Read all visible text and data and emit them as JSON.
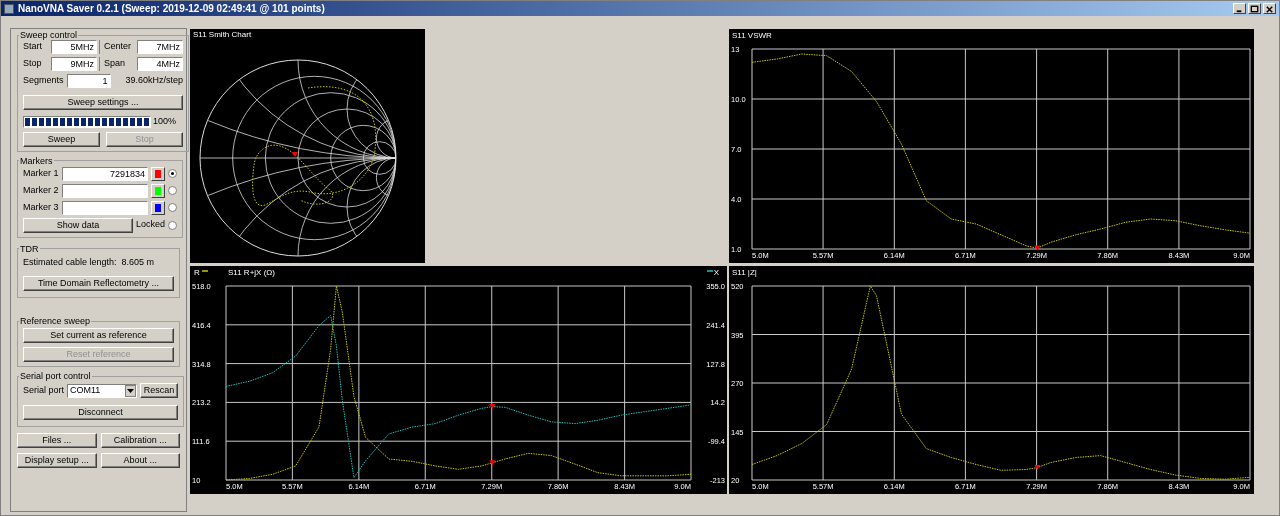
{
  "window": {
    "title": "NanoVNA Saver 0.2.1 (Sweep: 2019-12-09 02:49:41 @ 101 points)"
  },
  "window_controls": [
    {
      "kind": "minimize"
    },
    {
      "kind": "maximize"
    },
    {
      "kind": "close"
    }
  ],
  "sweep_control": {
    "title": "Sweep control",
    "fields": [
      {
        "label": "Start",
        "value": "5MHz"
      },
      {
        "label": "Center",
        "value": "7MHz"
      },
      {
        "label": "Stop",
        "value": "9MHz"
      },
      {
        "label": "Span",
        "value": "4MHz"
      }
    ],
    "segments": {
      "label": "Segments",
      "value": "1"
    },
    "step": "39.60kHz/step",
    "settings_button": "Sweep settings ...",
    "progress": {
      "level": 1,
      "reading": "100%"
    },
    "buttons": [
      {
        "label": "Sweep",
        "disabled": false
      },
      {
        "label": "Stop",
        "disabled": true
      }
    ]
  },
  "markers": {
    "title": "Markers",
    "items": [
      {
        "label": "Marker 1",
        "value": "7291834",
        "color": "#ff0000",
        "selected": true
      },
      {
        "label": "Marker 2",
        "color": "#00ff00",
        "selected": false
      },
      {
        "label": "Marker 3",
        "color": "#0000ff",
        "selected": false
      }
    ],
    "show_data_button": "Show data",
    "locked": {
      "label": "Locked",
      "selected": false
    }
  },
  "tdr": {
    "title": "TDR",
    "cable_length": "Estimated cable length:  8.605 m",
    "button": "Time Domain Reflectometry ..."
  },
  "reference_sweep": {
    "title": "Reference sweep",
    "buttons": [
      {
        "label": "Set current as reference",
        "disabled": false
      },
      {
        "label": "Reset reference",
        "disabled": true
      }
    ]
  },
  "serial_port": {
    "title": "Serial port control",
    "label": "Serial port",
    "port": "COM11",
    "rescan_button": "Rescan",
    "disconnect_button": "Disconnect"
  },
  "bottom_buttons": [
    "Files ...",
    "Calibration ...",
    "Display setup ...",
    "About ..."
  ],
  "smith_chart": {
    "title": "S11 Smith Chart"
  },
  "vswr_chart": {
    "chart_data": {
      "type": "line",
      "title": "S11 VSWR",
      "x": [
        5.0,
        5.2,
        5.4,
        5.6,
        5.8,
        6.0,
        6.2,
        6.4,
        6.6,
        6.8,
        7.0,
        7.2,
        7.29,
        7.4,
        7.6,
        7.8,
        8.0,
        8.2,
        8.4,
        8.6,
        8.8,
        9.0
      ],
      "xlim": [
        5,
        9
      ],
      "ylim": [
        1,
        13
      ],
      "xticks": [
        {
          "value": 5,
          "label": "5.0M"
        },
        {
          "value": 5.571,
          "label": "5.57M"
        },
        {
          "value": 6.143,
          "label": "6.14M"
        },
        {
          "value": 6.714,
          "label": "6.71M"
        },
        {
          "value": 7.286,
          "label": "7.29M"
        },
        {
          "value": 7.857,
          "label": "7.86M"
        },
        {
          "value": 8.429,
          "label": "8.43M"
        },
        {
          "value": 9,
          "label": "9.0M"
        }
      ],
      "yticks": [
        {
          "value": 1,
          "label": "1.0"
        },
        {
          "value": 4,
          "label": "4.0"
        },
        {
          "value": 7,
          "label": "7.0"
        },
        {
          "value": 10,
          "label": "10.0"
        },
        13
      ],
      "series": [
        {
          "color": "#c8c800",
          "line_style": "dotted",
          "values": [
            12.2,
            12.4,
            12.7,
            12.6,
            11.65,
            9.85,
            7.3,
            3.9,
            2.8,
            2.5,
            1.85,
            1.2,
            1.05,
            1.4,
            1.85,
            2.2,
            2.6,
            2.8,
            2.7,
            2.4,
            2.15,
            1.95
          ]
        }
      ],
      "grid": true
    }
  },
  "rjx_chart": {
    "chart_data": {
      "type": "line",
      "title": "S11 R+jX (Ω)",
      "x": [
        5.0,
        5.2,
        5.4,
        5.6,
        5.8,
        5.9,
        5.95,
        6.0,
        6.1,
        6.2,
        6.4,
        6.6,
        6.8,
        7.0,
        7.2,
        7.29,
        7.4,
        7.6,
        7.8,
        8.0,
        8.2,
        8.4,
        8.6,
        8.8,
        9.0
      ],
      "xlim": [
        5,
        9
      ],
      "ylim": [
        10,
        518
      ],
      "y2lim": [
        -213,
        355
      ],
      "xticks": [
        {
          "value": 5,
          "label": "5.0M"
        },
        {
          "value": 5.571,
          "label": "5.57M"
        },
        {
          "value": 6.143,
          "label": "6.14M"
        },
        {
          "value": 6.714,
          "label": "6.71M"
        },
        {
          "value": 7.286,
          "label": "7.29M"
        },
        {
          "value": 7.857,
          "label": "7.86M"
        },
        {
          "value": 8.429,
          "label": "8.43M"
        },
        {
          "value": 9,
          "label": "9.0M"
        }
      ],
      "yticks": [
        10,
        {
          "value": 111.6,
          "label": "111.6"
        },
        {
          "value": 213.2,
          "label": "213.2"
        },
        {
          "value": 314.8,
          "label": "314.8"
        },
        {
          "value": 416.4,
          "label": "416.4"
        },
        {
          "value": 518,
          "label": "518.0"
        }
      ],
      "y2ticks": [
        -213,
        {
          "value": -99.4,
          "label": "-99.4"
        },
        {
          "value": 14.2,
          "label": "14.2"
        },
        {
          "value": 127.8,
          "label": "127.8"
        },
        {
          "value": 241.4,
          "label": "241.4"
        },
        {
          "value": 355,
          "label": "355.0"
        }
      ],
      "series": [
        {
          "name": "R",
          "color": "#c8c800",
          "line_style": "dotted",
          "values": [
            10,
            14,
            25,
            47,
            149,
            352,
            518,
            450,
            229,
            122,
            65,
            59,
            47,
            38,
            47,
            55,
            65,
            80,
            74,
            52,
            29,
            21,
            21,
            21,
            25
          ]
        },
        {
          "name": "X",
          "color": "#20c0c0",
          "line_style": "dotted",
          "axis": "y2",
          "values": [
            61,
            76,
            101,
            150,
            239,
            269,
            180,
            21,
            -206,
            -157,
            -78,
            -58,
            -48,
            -23,
            -3,
            2,
            0,
            -23,
            -43,
            -48,
            -38,
            -23,
            -13,
            -3,
            7
          ]
        }
      ],
      "grid": true,
      "legend": "top"
    }
  },
  "z_chart": {
    "chart_data": {
      "type": "line",
      "title": "S11 |Z|",
      "x": [
        5.0,
        5.2,
        5.4,
        5.6,
        5.8,
        5.95,
        6.0,
        6.2,
        6.4,
        6.6,
        6.8,
        7.0,
        7.2,
        7.29,
        7.4,
        7.6,
        7.8,
        8.0,
        8.2,
        8.4,
        8.6,
        8.8,
        9.0
      ],
      "xlim": [
        5,
        9
      ],
      "ylim": [
        20,
        520
      ],
      "xticks": [
        {
          "value": 5,
          "label": "5.0M"
        },
        {
          "value": 5.571,
          "label": "5.57M"
        },
        {
          "value": 6.143,
          "label": "6.14M"
        },
        {
          "value": 6.714,
          "label": "6.71M"
        },
        {
          "value": 7.286,
          "label": "7.29M"
        },
        {
          "value": 7.857,
          "label": "7.86M"
        },
        {
          "value": 8.429,
          "label": "8.43M"
        },
        {
          "value": 9,
          "label": "9.0M"
        }
      ],
      "yticks": [
        20,
        145,
        270,
        395,
        520
      ],
      "series": [
        {
          "color": "#c8c800",
          "line_style": "dotted",
          "values": [
            60,
            83,
            114,
            163,
            306,
            520,
            495,
            190,
            101,
            78,
            60,
            45,
            47,
            52,
            65,
            78,
            83,
            65,
            47,
            33,
            24,
            22,
            27
          ]
        }
      ],
      "grid": true
    }
  }
}
